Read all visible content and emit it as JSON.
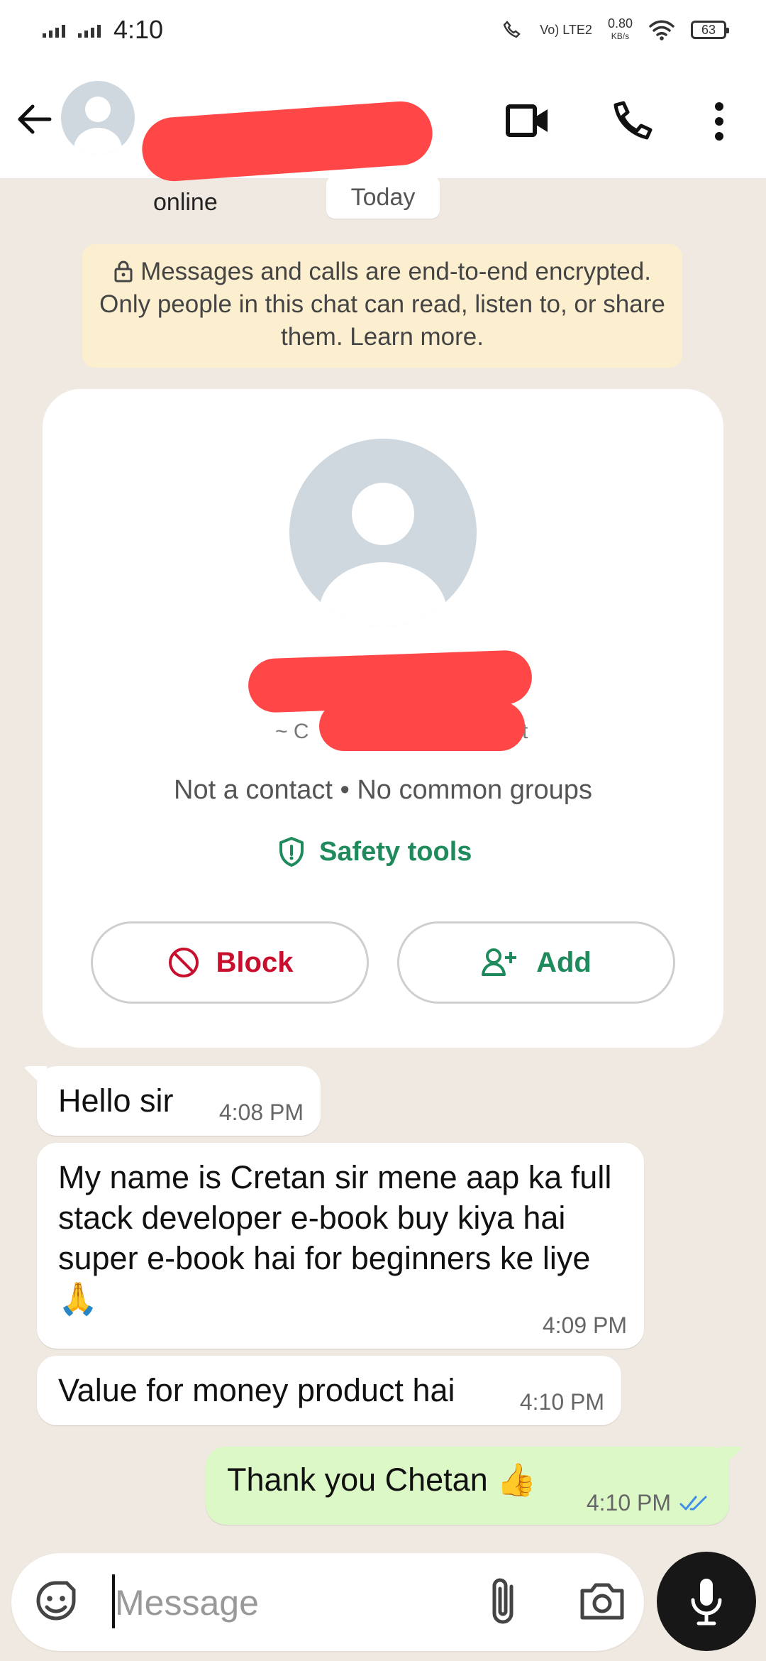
{
  "status_bar": {
    "time": "4:10",
    "network_label": "Vo) LTE2",
    "speed_value": "0.80",
    "speed_unit": "KB/s",
    "battery": "63"
  },
  "header": {
    "status": "online",
    "icons": [
      "back-arrow-icon",
      "video-call-icon",
      "phone-icon",
      "more-vertical-icon"
    ]
  },
  "chat": {
    "date_label": "Today",
    "encryption_notice": "Messages and calls are end-to-end encrypted. Only people in this chat can read, listen to, or share them. Learn more."
  },
  "profile_card": {
    "tilde_fragment": "~ C",
    "t_fragment": "t",
    "contact_info": "Not a contact • No common groups",
    "safety_tools_label": "Safety tools",
    "block_label": "Block",
    "add_label": "Add"
  },
  "messages": [
    {
      "direction": "in",
      "text": "Hello sir",
      "time": "4:08 PM"
    },
    {
      "direction": "in",
      "text": "My name is Cretan sir mene aap ka full stack developer e-book buy kiya hai super e-book hai for beginners ke liye 🙏",
      "time": "4:09 PM"
    },
    {
      "direction": "in",
      "text": "Value for money product hai",
      "time": "4:10 PM"
    },
    {
      "direction": "out",
      "text": "Thank you Chetan 👍",
      "time": "4:10 PM",
      "status": "read"
    }
  ],
  "composer": {
    "placeholder": "Message",
    "icons": [
      "sticker-icon",
      "attachment-icon",
      "camera-icon",
      "microphone-icon"
    ]
  },
  "colors": {
    "accent": "#1f8a5b",
    "danger": "#c8102e",
    "outgoing_bubble": "#dcf8c6",
    "chat_background": "#efe9e1",
    "redaction": "#ff4747"
  }
}
